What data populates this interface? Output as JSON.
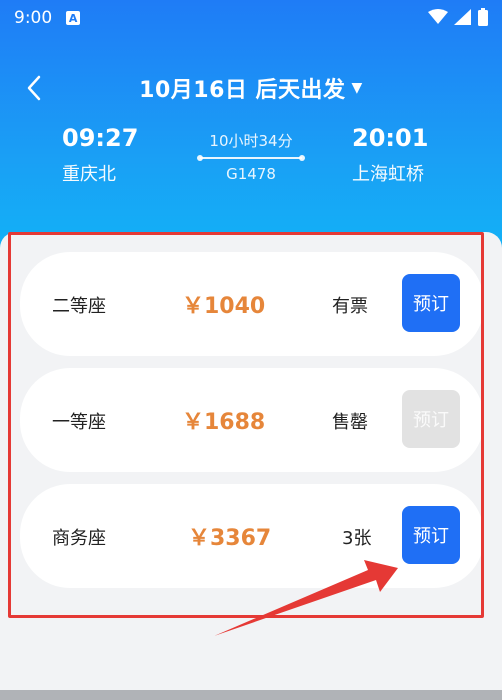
{
  "status_bar": {
    "time": "9:00",
    "notification_icon": "A",
    "icons": [
      "wifi-icon",
      "signal-icon",
      "battery-icon"
    ]
  },
  "header": {
    "date_label": "10月16日 后天出发",
    "back_icon": "chevron-left-icon",
    "dropdown_icon": "caret-down-icon"
  },
  "trip": {
    "depart_time": "09:27",
    "depart_station": "重庆北",
    "duration": "10小时34分",
    "train_no": "G1478",
    "arrive_time": "20:01",
    "arrive_station": "上海虹桥"
  },
  "seats": [
    {
      "name": "二等座",
      "price": "￥1040",
      "status": "有票",
      "button": "预订",
      "enabled": true
    },
    {
      "name": "一等座",
      "price": "￥1688",
      "status": "售罄",
      "button": "预订",
      "enabled": false
    },
    {
      "name": "商务座",
      "price": "￥3367",
      "status": "3张",
      "button": "预订",
      "enabled": true
    }
  ],
  "colors": {
    "brand_blue": "#1f6ff5",
    "price_orange": "#e6863a",
    "annotation_red": "#e53935"
  }
}
